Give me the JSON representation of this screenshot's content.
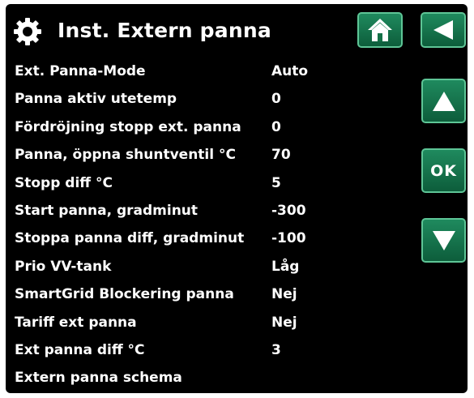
{
  "header": {
    "title": "Inst. Extern panna",
    "icons": {
      "settings": "gear-icon",
      "home": "home-icon",
      "back": "back-arrow-icon"
    }
  },
  "nav": {
    "ok_label": "OK",
    "icons": {
      "up": "arrow-up-icon",
      "down": "arrow-down-icon"
    }
  },
  "colors": {
    "background": "#000000",
    "text": "#ffffff",
    "button_fill": "#157148",
    "button_border": "#5ec596"
  },
  "menu": {
    "items": [
      {
        "label": "Ext. Panna-Mode",
        "value": "Auto"
      },
      {
        "label": "Panna aktiv utetemp",
        "value": "0"
      },
      {
        "label": "Fördröjning stopp ext. panna",
        "value": "0"
      },
      {
        "label": "Panna, öppna shuntventil °C",
        "value": "70"
      },
      {
        "label": "Stopp diff °C",
        "value": "5"
      },
      {
        "label": "Start panna, gradminut",
        "value": "-300"
      },
      {
        "label": "Stoppa panna diff, gradminut",
        "value": "-100"
      },
      {
        "label": "Prio VV-tank",
        "value": "Låg"
      },
      {
        "label": "SmartGrid Blockering panna",
        "value": "Nej"
      },
      {
        "label": "Tariff ext panna",
        "value": "Nej"
      },
      {
        "label": "Ext panna diff °C",
        "value": "3"
      },
      {
        "label": "Extern panna schema",
        "value": ""
      }
    ]
  }
}
